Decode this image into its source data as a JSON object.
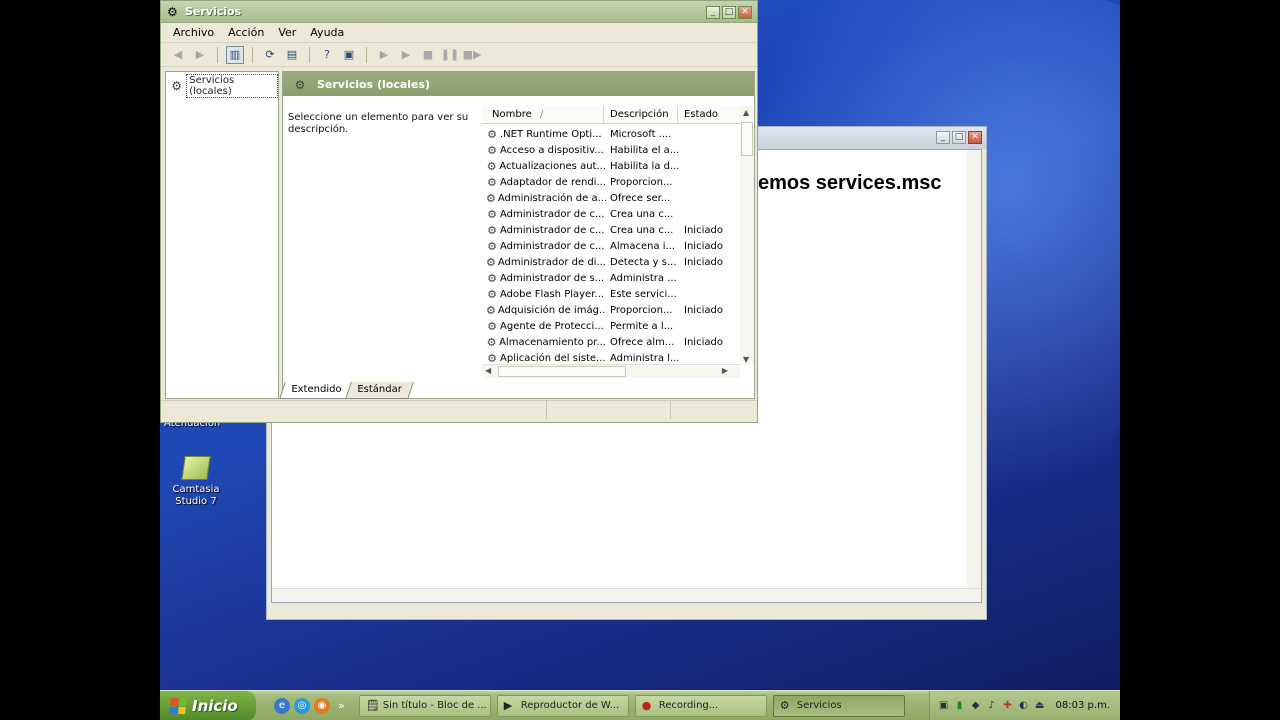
{
  "desktop": {
    "partial_icon_label": "Atenuación",
    "icons": [
      {
        "label_line1": "Camtasia",
        "label_line2": "Studio 7",
        "icon": "camtasia-icon"
      }
    ]
  },
  "background_window": {
    "text": "emos services.msc"
  },
  "services_window": {
    "title": "Servicios",
    "menu": [
      "Archivo",
      "Acción",
      "Ver",
      "Ayuda"
    ],
    "tree_root": "Servicios (locales)",
    "pane_title": "Servicios (locales)",
    "description_prompt": "Seleccione un elemento para ver su descripción.",
    "columns": {
      "name": "Nombre",
      "sort_indicator": "/",
      "description": "Descripción",
      "status": "Estado"
    },
    "rows": [
      {
        "name": ".NET Runtime Opti...",
        "description": "Microsoft ....",
        "status": ""
      },
      {
        "name": "Acceso a dispositiv...",
        "description": "Habilita el a...",
        "status": ""
      },
      {
        "name": "Actualizaciones aut...",
        "description": "Habilita la d...",
        "status": ""
      },
      {
        "name": "Adaptador de rendi...",
        "description": "Proporcion...",
        "status": ""
      },
      {
        "name": "Administración de a...",
        "description": "Ofrece ser...",
        "status": ""
      },
      {
        "name": "Administrador de c...",
        "description": "Crea una c...",
        "status": ""
      },
      {
        "name": "Administrador de c...",
        "description": "Crea una c...",
        "status": "Iniciado"
      },
      {
        "name": "Administrador de c...",
        "description": "Almacena i...",
        "status": "Iniciado"
      },
      {
        "name": "Administrador de di...",
        "description": "Detecta y s...",
        "status": "Iniciado"
      },
      {
        "name": "Administrador de s...",
        "description": "Administra ...",
        "status": ""
      },
      {
        "name": "Adobe Flash Player...",
        "description": "Este servici...",
        "status": ""
      },
      {
        "name": "Adquisición de imág...",
        "description": "Proporcion...",
        "status": "Iniciado"
      },
      {
        "name": "Agente de Protecci...",
        "description": "Permite a l...",
        "status": ""
      },
      {
        "name": "Almacenamiento pr...",
        "description": "Ofrece alm...",
        "status": "Iniciado"
      },
      {
        "name": "Aplicación del siste...",
        "description": "Administra l...",
        "status": ""
      }
    ],
    "tabs": [
      "Extendido",
      "Estándar"
    ]
  },
  "taskbar": {
    "start_label": "Inicio",
    "chevron": "»",
    "tasks": [
      {
        "label": "Sin título - Bloc de ...",
        "icon": "notepad-icon"
      },
      {
        "label": "Reproductor de W...",
        "icon": "media-player-icon"
      },
      {
        "label": "Recording...",
        "icon": "recording-icon"
      },
      {
        "label": "Servicios",
        "icon": "services-gear-icon"
      }
    ],
    "clock": "08:03 p.m."
  }
}
